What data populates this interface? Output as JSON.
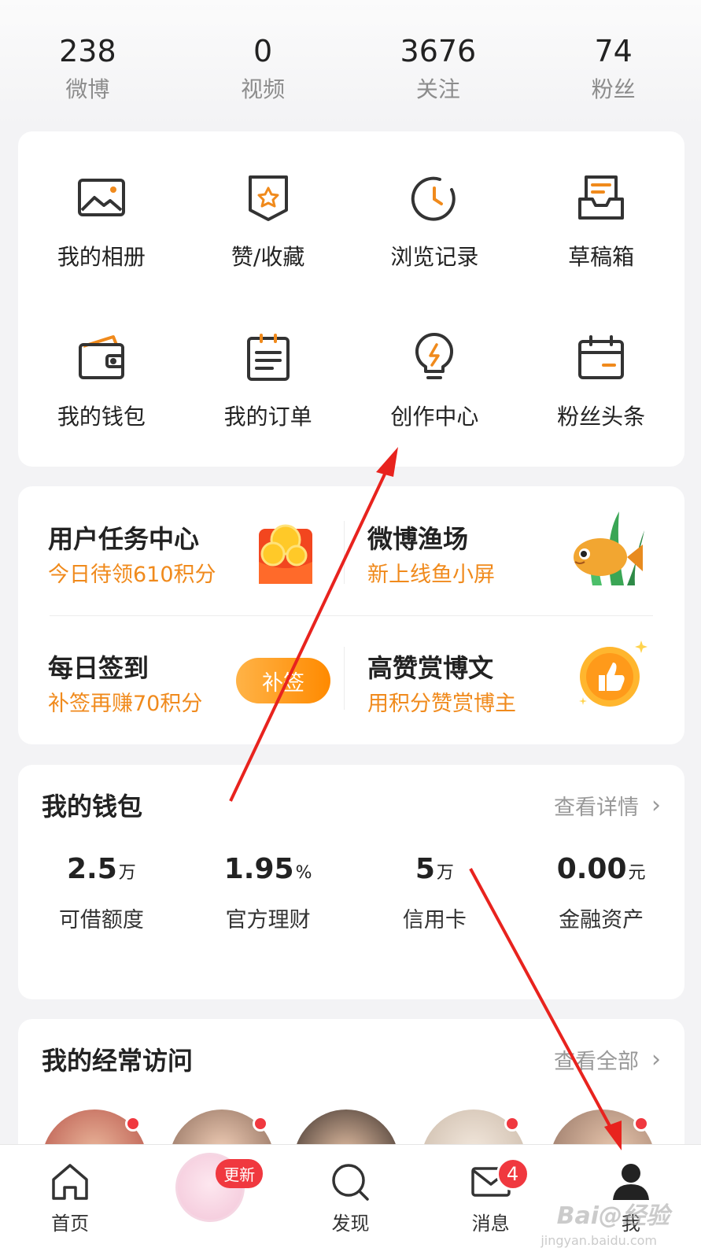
{
  "stats": [
    {
      "num": "238",
      "label": "微博"
    },
    {
      "num": "0",
      "label": "视频"
    },
    {
      "num": "3676",
      "label": "关注"
    },
    {
      "num": "74",
      "label": "粉丝"
    }
  ],
  "menu": [
    {
      "label": "我的相册",
      "icon": "album-icon"
    },
    {
      "label": "赞/收藏",
      "icon": "favorite-icon"
    },
    {
      "label": "浏览记录",
      "icon": "history-icon"
    },
    {
      "label": "草稿箱",
      "icon": "drafts-icon"
    },
    {
      "label": "我的钱包",
      "icon": "wallet-icon"
    },
    {
      "label": "我的订单",
      "icon": "orders-icon"
    },
    {
      "label": "创作中心",
      "icon": "lightbulb-icon"
    },
    {
      "label": "粉丝头条",
      "icon": "calendar-icon"
    }
  ],
  "tasks": {
    "task_center": {
      "title": "用户任务中心",
      "sub": "今日待领610积分"
    },
    "fishery": {
      "title": "微博渔场",
      "sub": "新上线鱼小屏"
    },
    "checkin": {
      "title": "每日签到",
      "sub": "补签再赚70积分",
      "button": "补签"
    },
    "reward": {
      "title": "高赞赏博文",
      "sub": "用积分赞赏博主"
    }
  },
  "wallet": {
    "title": "我的钱包",
    "more": "查看详情",
    "items": [
      {
        "value": "2.5",
        "unit": "万",
        "label": "可借额度"
      },
      {
        "value": "1.95",
        "unit": "%",
        "label": "官方理财"
      },
      {
        "value": "5",
        "unit": "万",
        "label": "信用卡"
      },
      {
        "value": "0.00",
        "unit": "元",
        "label": "金融资产"
      }
    ]
  },
  "frequent": {
    "title": "我的经常访问",
    "more": "查看全部"
  },
  "tabbar": {
    "home": "首页",
    "update_badge": "更新",
    "discover": "发现",
    "messages": "消息",
    "messages_badge": "4",
    "me": "我"
  },
  "colors": {
    "accent_orange": "#f08a1c",
    "badge_red": "#f0383f",
    "annotation_arrow": "#e8231e"
  },
  "watermark": {
    "main": "Bai@经验",
    "sub": "jingyan.baidu.com"
  }
}
